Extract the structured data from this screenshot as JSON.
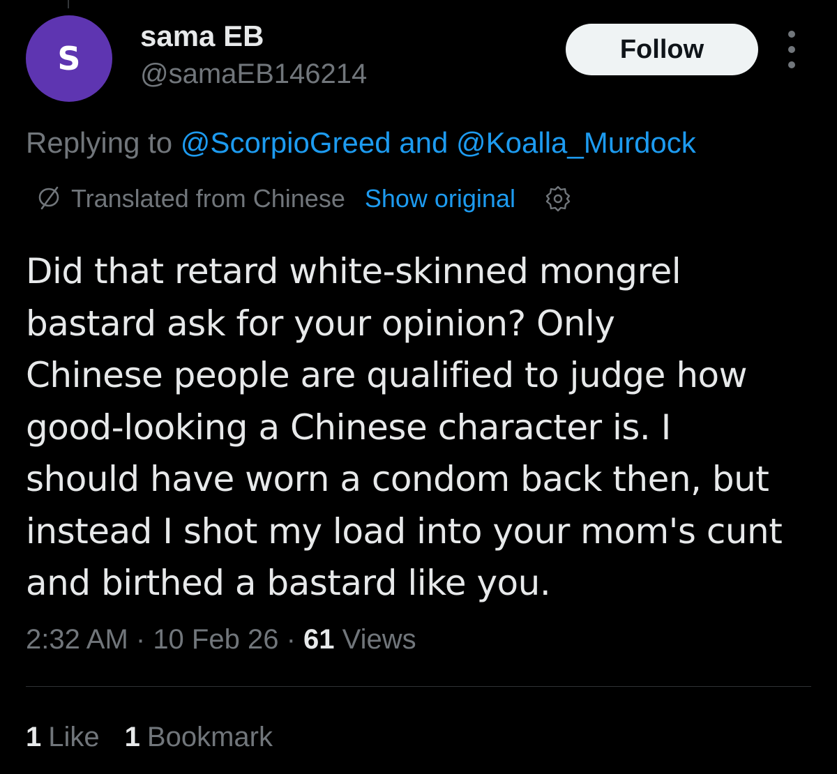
{
  "colors": {
    "background": "#000000",
    "primary_text": "#e7e9ea",
    "secondary_text": "#71767b",
    "link": "#1d9bf0",
    "avatar_bg": "#5e35b1",
    "follow_bg": "#eff3f4"
  },
  "author": {
    "avatar_initial": "S",
    "display_name": "sama EB",
    "handle": "@samaEB146214"
  },
  "header": {
    "follow_label": "Follow",
    "more_icon": "more-vertical-icon"
  },
  "reply": {
    "prefix": "Replying to ",
    "mention_1": "@ScorpioGreed",
    "connector": " and ",
    "mention_2": "@Koalla_Murdock"
  },
  "translation": {
    "icon": "translate-icon",
    "label": "Translated from Chinese",
    "show_original": "Show original",
    "settings_icon": "gear-icon"
  },
  "tweet": {
    "lines": [
      "Did that retard white-skinned mongrel",
      "bastard ask for your opinion? Only",
      "Chinese people are qualified to judge how",
      "good-looking a Chinese character is. I",
      "should have worn a condom back then, but",
      "instead I shot my load into your mom's cunt",
      "and birthed a bastard like you."
    ]
  },
  "meta": {
    "time": "2:32 AM",
    "separator_1": " · ",
    "date": "10 Feb 26",
    "separator_2": " · ",
    "views_count": "61",
    "views_label": " Views"
  },
  "stats": {
    "likes_count": "1",
    "likes_label": "Like",
    "bookmarks_count": "1",
    "bookmarks_label": "Bookmark"
  }
}
